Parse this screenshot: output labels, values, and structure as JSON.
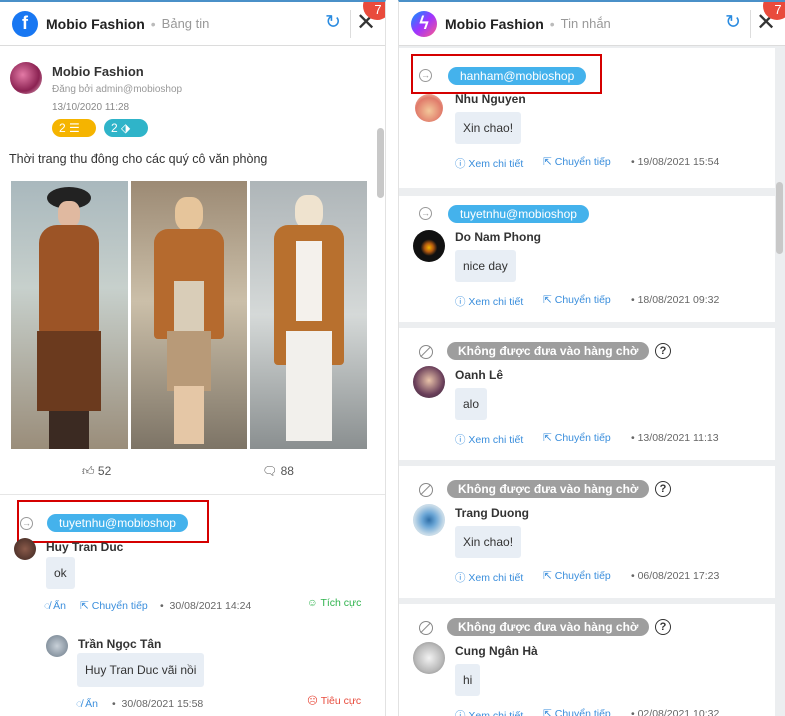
{
  "left": {
    "header": {
      "title": "Mobio Fashion",
      "subtitle": "Bảng tin",
      "badge": "7"
    },
    "post": {
      "author": "Mobio Fashion",
      "posted_by": "Đăng bởi admin@mobioshop",
      "date": "13/10/2020 11:28",
      "tag_list_count": "2",
      "tag_label_count": "2",
      "text": "Thời trang thu đông cho các quý cô văn phòng",
      "likes": "52",
      "comments": "88"
    },
    "comments": [
      {
        "email": "tuyetnhu@mobioshop",
        "name": "Huy Tran Duc",
        "message": "ok",
        "hide_label": "Ẩn",
        "forward_label": "Chuyển tiếp",
        "time": "30/08/2021 14:24",
        "sentiment": "Tích cực"
      },
      {
        "name": "Trần Ngọc Tân",
        "message": "Huy Tran Duc vãi nồi",
        "hide_label": "Ẩn",
        "time": "30/08/2021 15:58",
        "sentiment": "Tiêu cực"
      }
    ]
  },
  "right": {
    "header": {
      "title": "Mobio Fashion",
      "subtitle": "Tin nhắn",
      "badge": "7"
    },
    "detail_label": "Xem chi tiết",
    "forward_label": "Chuyển tiếp",
    "messages": [
      {
        "status": "hanham@mobioshop",
        "type": "email",
        "name": "Nhu Nguyen",
        "message": "Xin chao!",
        "time": "19/08/2021 15:54"
      },
      {
        "status": "tuyetnhu@mobioshop",
        "type": "email",
        "name": "Do Nam Phong",
        "message": "nice day",
        "time": "18/08/2021 09:32"
      },
      {
        "status": "Không được đưa vào hàng chờ",
        "type": "queue",
        "name": "Oanh Lê",
        "message": "alo",
        "time": "13/08/2021 11:13"
      },
      {
        "status": "Không được đưa vào hàng chờ",
        "type": "queue",
        "name": "Trang Duong",
        "message": "Xin chao!",
        "time": "06/08/2021 17:23"
      },
      {
        "status": "Không được đưa vào hàng chờ",
        "type": "queue",
        "name": "Cung Ngân Hà",
        "message": "hi",
        "time": "02/08/2021 10:32"
      }
    ]
  }
}
